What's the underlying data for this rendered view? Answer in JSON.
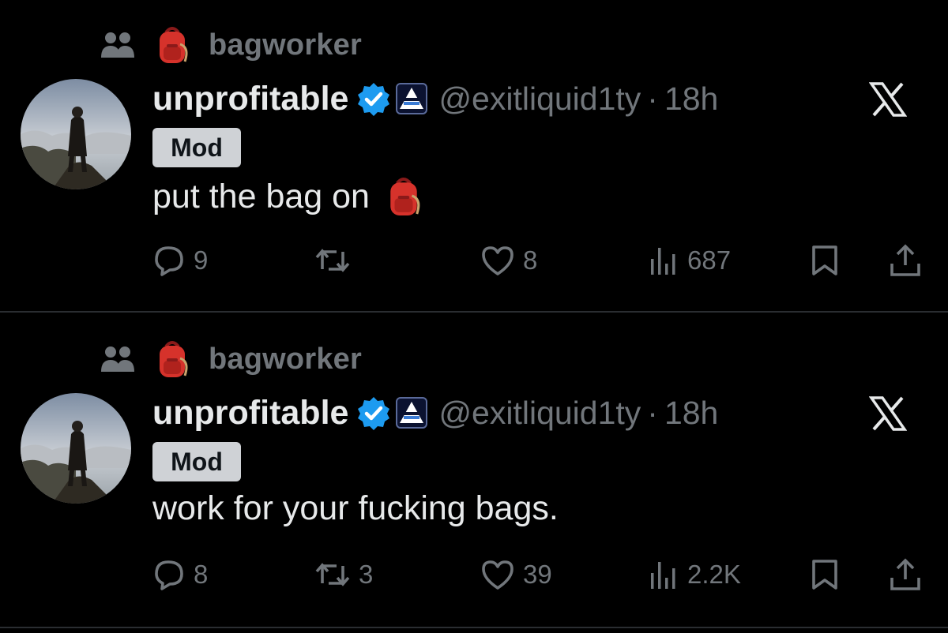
{
  "posts": [
    {
      "community": "bagworker",
      "display_name": "unprofitable",
      "handle": "@exitliquid1ty",
      "separator": "·",
      "time": "18h",
      "role_badge": "Mod",
      "text": "put the bag on",
      "replies": "9",
      "reposts": "",
      "likes": "8",
      "views": "687"
    },
    {
      "community": "bagworker",
      "display_name": "unprofitable",
      "handle": "@exitliquid1ty",
      "separator": "·",
      "time": "18h",
      "role_badge": "Mod",
      "text": "work for your fucking bags.",
      "replies": "8",
      "reposts": "3",
      "likes": "39",
      "views": "2.2K"
    }
  ],
  "icons": {
    "community": "community-members-icon",
    "backpack": "backpack-emoji",
    "verified": "verified-badge-icon",
    "affiliate": "affiliate-badge-icon",
    "close": "x-close-icon",
    "reply": "reply-icon",
    "repost": "repost-icon",
    "like": "like-icon",
    "views": "views-icon",
    "bookmark": "bookmark-icon",
    "share": "share-icon"
  },
  "colors": {
    "background": "#000000",
    "text": "#e7e9ea",
    "muted": "#71767b",
    "verified": "#1d9bf0",
    "mod_badge_bg": "#cfd2d6"
  }
}
